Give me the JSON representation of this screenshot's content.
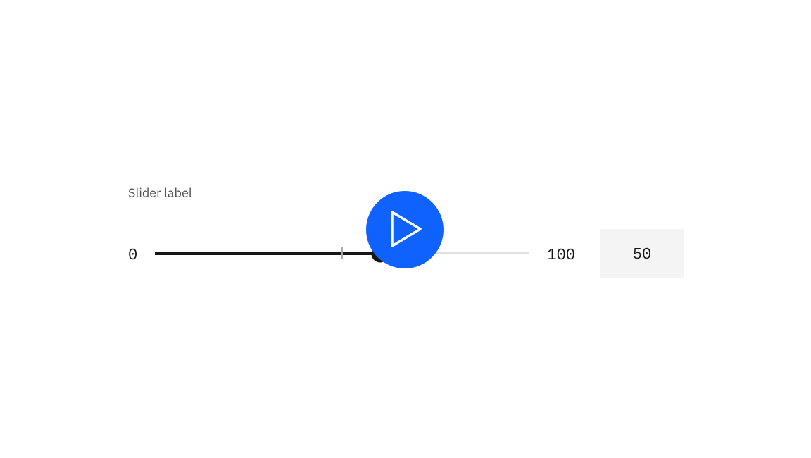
{
  "slider": {
    "label": "Slider label",
    "min": "0",
    "max": "100",
    "value": "50",
    "fill_percent": 60,
    "tick_percent": 50
  },
  "play_button": {
    "icon": "play"
  }
}
